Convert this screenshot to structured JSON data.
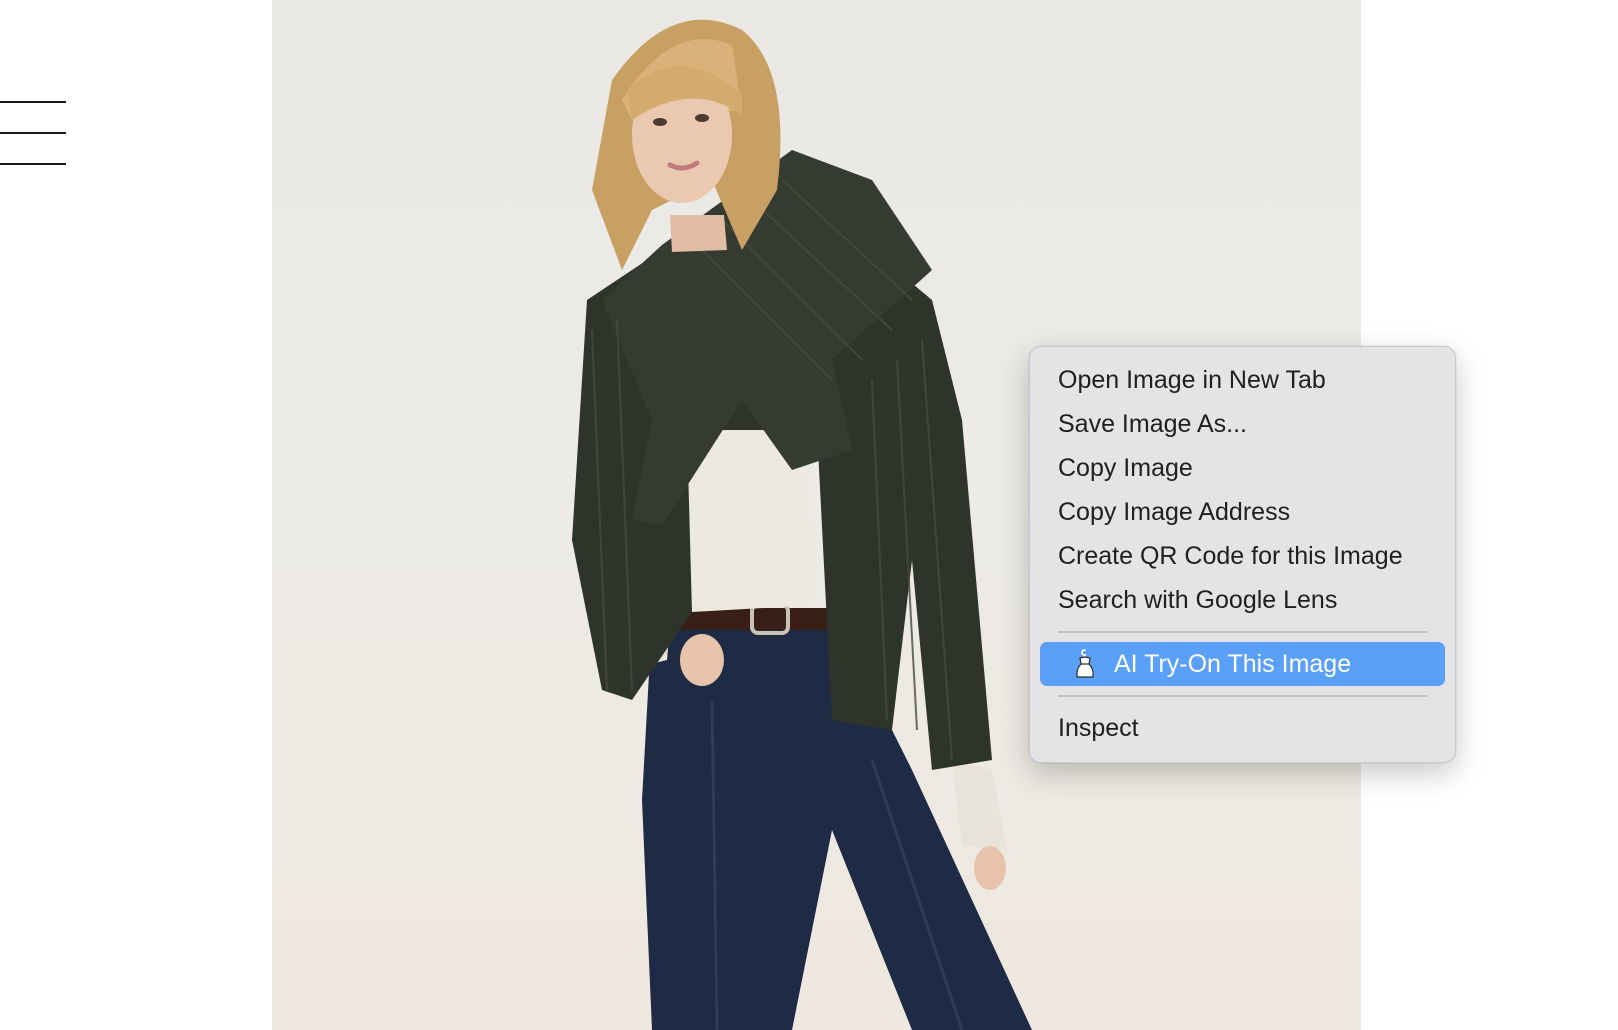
{
  "page": {
    "nav": {
      "menu_icon": "hamburger-menu-icon"
    },
    "product_image": {
      "alt": "Quilted jacket with scarf collar"
    }
  },
  "context_menu": {
    "items": [
      {
        "label": "Open Image in New Tab"
      },
      {
        "label": "Save Image As..."
      },
      {
        "label": "Copy Image"
      },
      {
        "label": "Copy Image Address"
      },
      {
        "label": "Create QR Code for this Image"
      },
      {
        "label": "Search with Google Lens"
      }
    ],
    "extension_item": {
      "label": "AI Try-On This Image",
      "icon": "dress-hanger-icon",
      "highlighted": true
    },
    "inspect": {
      "label": "Inspect"
    }
  },
  "colors": {
    "highlight": "#5aa0f8",
    "menu_bg": "#e4e4e7",
    "jacket": "#2f342a",
    "denim": "#1f2a44",
    "backdrop": "#ecebe7"
  }
}
